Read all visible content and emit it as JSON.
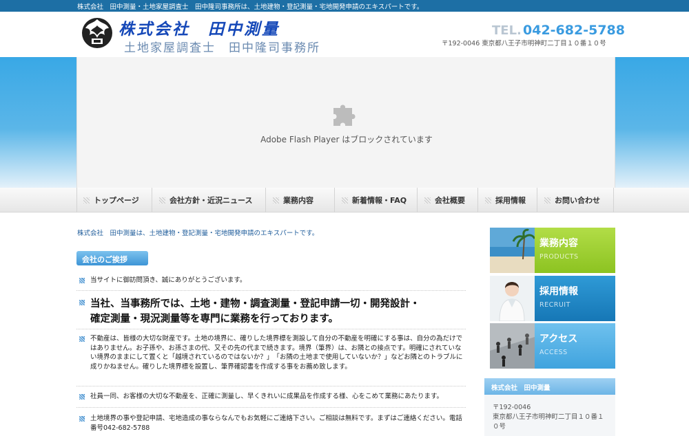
{
  "topbar": {
    "text": "株式会社　田中測量・土地家屋調査士　田中隆司事務所は、土地建物・登記測量・宅地開発申請のエキスパートです。"
  },
  "header": {
    "company_name": "株式会社　田中測量",
    "company_sub": "土地家屋調査士　田中隆司事務所",
    "tel_label": "TEL.",
    "tel_number": "042-682-5788",
    "address": "〒192-0046 東京都八王子市明神町二丁目１０番１０号"
  },
  "hero": {
    "flash_message": "Adobe Flash Player はブロックされています",
    "icon": "puzzle-piece-icon"
  },
  "nav": {
    "items": [
      {
        "label": "トップページ"
      },
      {
        "label": "会社方針・近況ニュース"
      },
      {
        "label": "業務内容"
      },
      {
        "label": "新着情報・FAQ"
      },
      {
        "label": "会社概要"
      },
      {
        "label": "採用情報"
      },
      {
        "label": "お問い合わせ"
      }
    ]
  },
  "main": {
    "tagline": "株式会社　田中測量は、土地建物・登記測量・宅地開発申請のエキスパートです。",
    "section_title": "会社のご挨拶",
    "greeting": "当サイトに御訪問頂き、誠にありがとうございます。",
    "headline_1": "当社、当事務所では、土地・建物・調査測量・登記申請一切・開発設計・",
    "headline_2": "確定測量・現況測量等を専門に業務を行っております。",
    "para_1": "不動産は、皆様の大切な財産です。土地の境界に、確りした境界標を測設して自分の不動産を明確にする事は、自分の為だけではありません。お子孫や、お孫さまの代、又その先の代まで続きます。境界（筆界）は、お隣との接点です。明確にされていない境界のままにして置くと「越境されているのではないか？」　「お隣の土地まで使用していないか？」などお隣とのトラブルに成りかねません。確りした境界標を設置し、筆界確認書を作成する事をお薦め致します。",
    "para_2": "社員一同、お客様の大切な不動産を、正確に測量し、早くきれいに成果品を作成する様、心をこめて業務にあたります。",
    "para_3": "土地境界の事や登記申請、宅地造成の事ならなんでもお気軽にご連絡下さい。ご相談は無料です。まずはご連絡ください。電話番号042-682-5788"
  },
  "sidebar": {
    "banners": [
      {
        "title": "業務内容",
        "sub": "PRODUCTS",
        "color": "#9ccf2e"
      },
      {
        "title": "採用情報",
        "sub": "RECRUIT",
        "color": "#1f88c7"
      },
      {
        "title": "アクセス",
        "sub": "ACCESS",
        "color": "#49aee3"
      }
    ],
    "box_title": "株式会社　田中測量",
    "postal": "〒192-0046",
    "address_1": "東京都八王子市明神町二丁目１０番１",
    "address_2": "０号"
  }
}
